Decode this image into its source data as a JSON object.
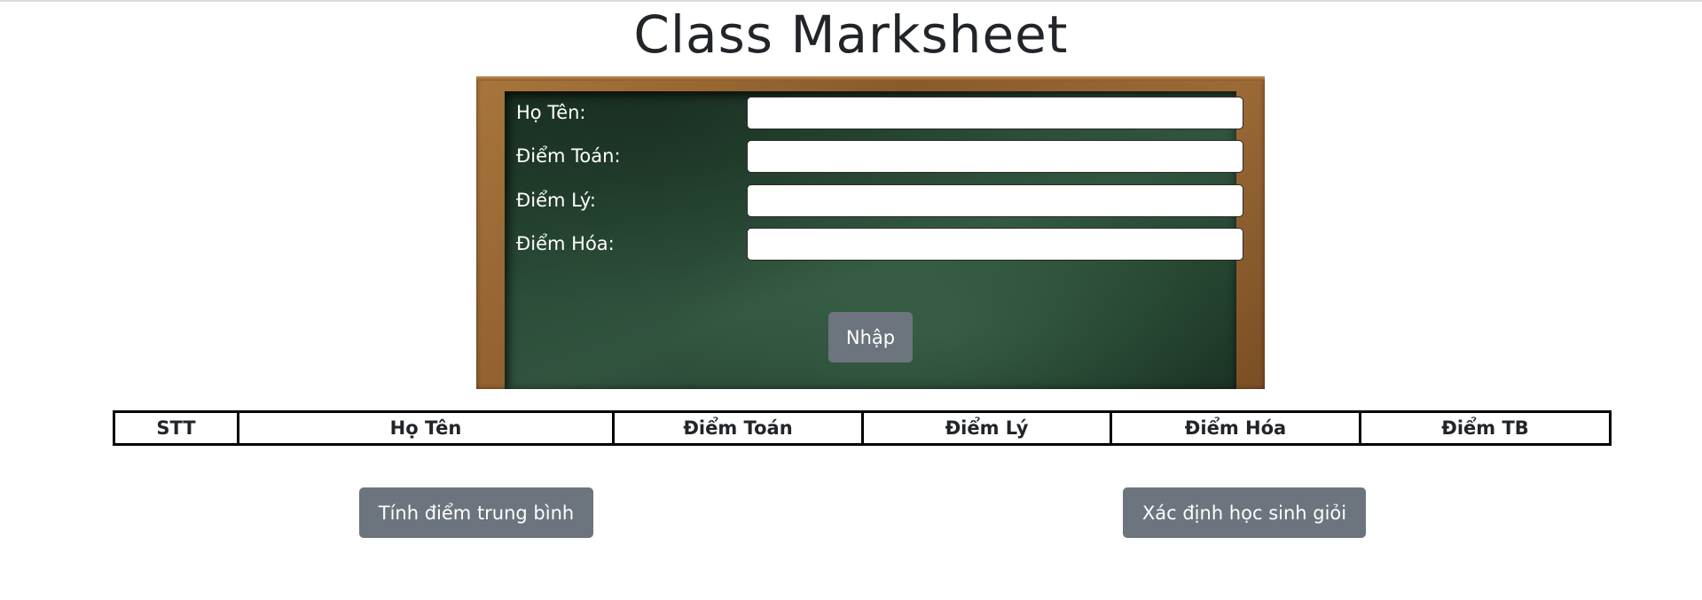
{
  "page": {
    "title": "Class Marksheet"
  },
  "form": {
    "fields": [
      {
        "label": "Họ Tên:",
        "value": "",
        "placeholder": ""
      },
      {
        "label": "Điểm Toán:",
        "value": "",
        "placeholder": ""
      },
      {
        "label": "Điểm Lý:",
        "value": "",
        "placeholder": ""
      },
      {
        "label": "Điểm Hóa:",
        "value": "",
        "placeholder": ""
      }
    ],
    "submit_label": "Nhập"
  },
  "table": {
    "headers": [
      "STT",
      "Họ Tên",
      "Điểm Toán",
      "Điểm Lý",
      "Điểm Hóa",
      "Điểm TB"
    ],
    "rows": []
  },
  "actions": {
    "average_label": "Tính điểm trung bình",
    "excellent_label": "Xác định học sinh giỏi"
  },
  "colors": {
    "button_bg": "#6c757d",
    "board_green": "#2b4d38",
    "frame_wood": "#8a5a2b"
  }
}
